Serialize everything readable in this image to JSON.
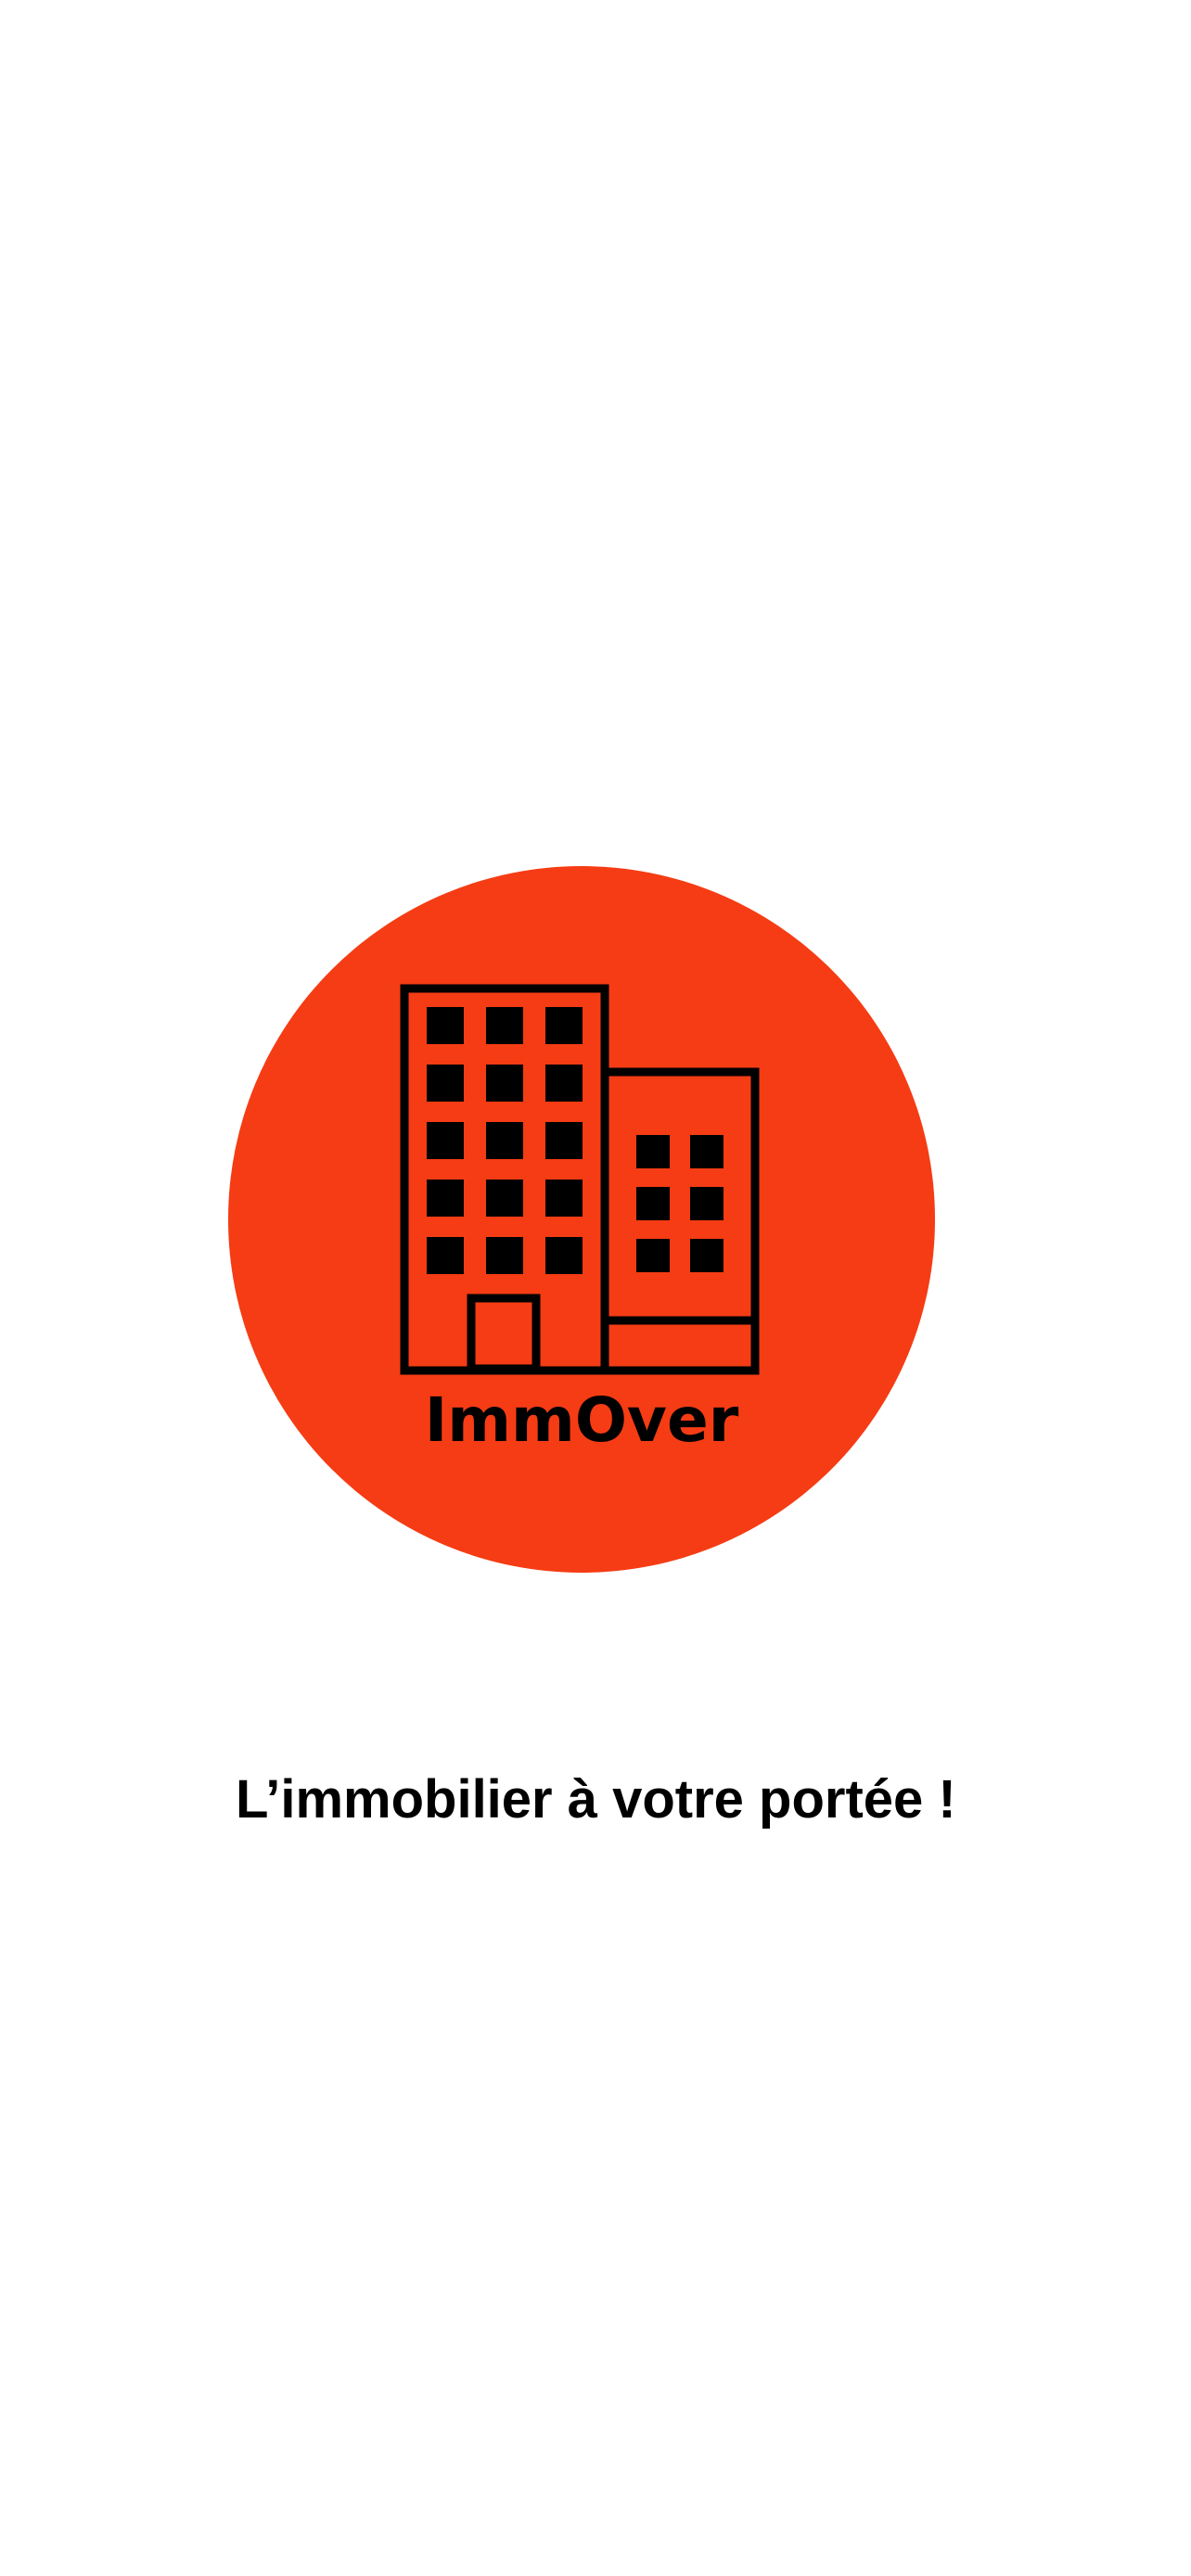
{
  "splash": {
    "logo": {
      "brand_name": "ImmOver",
      "icon": "buildings-icon",
      "circle_color": "#F53C14",
      "ink_color": "#000000"
    },
    "tagline": "L’immobilier à votre portée !"
  },
  "colors": {
    "background": "#FFFFFF",
    "text": "#000000"
  }
}
